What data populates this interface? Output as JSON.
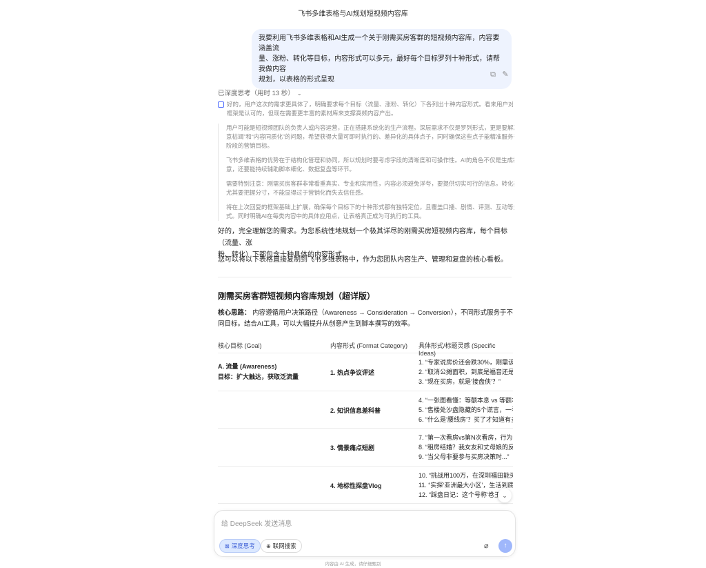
{
  "title": "飞书多维表格与AI规划短视频内容库",
  "user_message": {
    "lines": [
      "我要利用飞书多维表格和AI生成一个关于刚需买房客群的短视频内容库，内容要涵盖流",
      "量、涨粉、转化等目标，内容形式可以多元，最好每个目标罗列十种形式，请帮我做内容",
      "规划，以表格的形式呈现"
    ]
  },
  "thinking": {
    "header": "已深度思考（用时 13 秒）",
    "first": [
      "好的，用户这次的需求更具体了，明确要求每个目标（流量、涨粉、转化）下各列出十种内容形式。看来用户对之前的",
      "框架是认可的，但现在需要更丰富的素材库来支撑高频内容产出。"
    ],
    "paragraphs": [
      [
        "用户可能是短视频团队的负责人或内容运营，正在搭建系统化的生产流程。深层需求不仅是罗列形式，更是要解决“创",
        "意枯竭”和“内容同质化”的问题，希望获得大量可即时执行的、差异化的具体点子，同时确保这些点子能精准服务于不同",
        "阶段的营销目标。"
      ],
      [
        "飞书多维表格的优势在于结构化管理和协同，所以规划时要考虑字段的清晰度和可操作性。AI的角色不仅是生成初始创",
        "意，还要能持续辅助脚本细化、数据复盘等环节。"
      ],
      [
        "需要特别注意：刚需买房客群非常看重真实、专业和实用性，内容必须避免浮夸，要提供切实可行的信息。转化类内容",
        "尤其要把握分寸，不能显得过于营销化而失去信任感。"
      ],
      [
        "将在上次回复的框架基础上扩展，确保每个目标下的十种形式都有独特定位，且覆盖口播、剧情、评测、互动等多元形",
        "式。同时明确AI在每类内容中的具体应用点，让表格真正成为可执行的工具。"
      ]
    ]
  },
  "answer": {
    "p1": [
      "好的，完全理解您的需求。为您系统性地规划一个极其详尽的刚需买房短视频内容库，每个目标（流量、涨",
      "粉、转化）下都包含十种具体的内容形式。"
    ],
    "p2": "您可以将以下表格直接复制到飞书多维表格中，作为您团队内容生产、管理和复盘的核心看板。",
    "heading": "刚需买房客群短视频内容库规划（超详版）",
    "core_label": "核心思路：",
    "core_lines": [
      " 内容遵循用户决策路径（Awareness → Consideration → Conversion），不同形式服务于不",
      "同目标。结合AI工具，可以大幅提升从创意产生到脚本撰写的效率。"
    ]
  },
  "table": {
    "headers": [
      "核心目标 (Goal)",
      "内容形式 (Format Category)",
      "具体形式/标题灵感 (Specific Ideas)"
    ],
    "goal_title": "A. 流量 (Awareness)",
    "goal_sub": "目标：扩大触达，获取泛流量",
    "rows": [
      {
        "format": "1. 热点争议评述",
        "ideas": [
          "1. “专家说房价还会跌30%，刚需该",
          "2. “取消公摊面积，到底是福音还是",
          "3. “现在买房，就是‘接盘侠’？”"
        ]
      },
      {
        "format": "2. 知识信息差科普",
        "ideas": [
          "4. “一张图看懂：等额本息 vs 等额本",
          "5. “售楼处沙盘隐藏的5个谎言，一看",
          "6. “什么是‘腰线房’？买了才知道有多"
        ]
      },
      {
        "format": "3. 情景痛点短剧",
        "ideas": [
          "7. “第一次看房vs第N次看房，行为变",
          "8. “租房结婚？我女友和丈母娘的反应",
          "9. “当父母非要参与买房决策时...”"
        ]
      },
      {
        "format": "4. 地标性探盘Vlog",
        "ideas": [
          "10. “挑战用100万，在深圳福田能买",
          "11. “实探‘亚洲最大小区’，生活到底",
          "12. “踩盘日记：这个号称‘卷王’的"
        ]
      }
    ]
  },
  "composer": {
    "placeholder": "给 DeepSeek 发送消息",
    "deep_think": "深度思考",
    "web_search": "联网搜索"
  },
  "footer": "内容由 AI 生成，请仔细甄别"
}
